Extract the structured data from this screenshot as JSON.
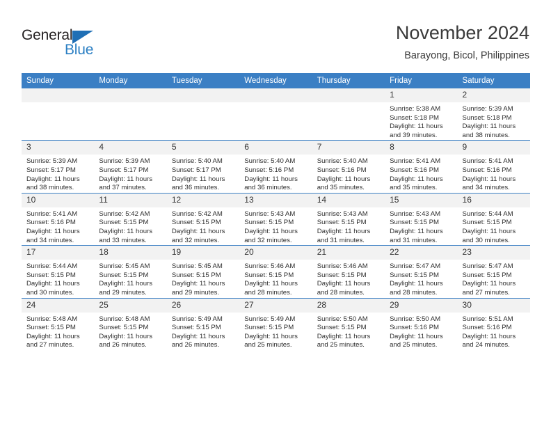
{
  "brand": {
    "name_top": "General",
    "name_bottom": "Blue"
  },
  "header": {
    "title": "November 2024",
    "subtitle": "Barayong, Bicol, Philippines"
  },
  "theme": {
    "accent": "#3b7fc4",
    "daynum_bg": "#f2f2f2",
    "text": "#2e2e2e"
  },
  "weekdays": [
    "Sunday",
    "Monday",
    "Tuesday",
    "Wednesday",
    "Thursday",
    "Friday",
    "Saturday"
  ],
  "weeks": [
    [
      {
        "day": "",
        "blank": true
      },
      {
        "day": "",
        "blank": true
      },
      {
        "day": "",
        "blank": true
      },
      {
        "day": "",
        "blank": true
      },
      {
        "day": "",
        "blank": true
      },
      {
        "day": "1",
        "sunrise": "Sunrise: 5:38 AM",
        "sunset": "Sunset: 5:18 PM",
        "daylight": "Daylight: 11 hours and 39 minutes."
      },
      {
        "day": "2",
        "sunrise": "Sunrise: 5:39 AM",
        "sunset": "Sunset: 5:18 PM",
        "daylight": "Daylight: 11 hours and 38 minutes."
      }
    ],
    [
      {
        "day": "3",
        "sunrise": "Sunrise: 5:39 AM",
        "sunset": "Sunset: 5:17 PM",
        "daylight": "Daylight: 11 hours and 38 minutes."
      },
      {
        "day": "4",
        "sunrise": "Sunrise: 5:39 AM",
        "sunset": "Sunset: 5:17 PM",
        "daylight": "Daylight: 11 hours and 37 minutes."
      },
      {
        "day": "5",
        "sunrise": "Sunrise: 5:40 AM",
        "sunset": "Sunset: 5:17 PM",
        "daylight": "Daylight: 11 hours and 36 minutes."
      },
      {
        "day": "6",
        "sunrise": "Sunrise: 5:40 AM",
        "sunset": "Sunset: 5:16 PM",
        "daylight": "Daylight: 11 hours and 36 minutes."
      },
      {
        "day": "7",
        "sunrise": "Sunrise: 5:40 AM",
        "sunset": "Sunset: 5:16 PM",
        "daylight": "Daylight: 11 hours and 35 minutes."
      },
      {
        "day": "8",
        "sunrise": "Sunrise: 5:41 AM",
        "sunset": "Sunset: 5:16 PM",
        "daylight": "Daylight: 11 hours and 35 minutes."
      },
      {
        "day": "9",
        "sunrise": "Sunrise: 5:41 AM",
        "sunset": "Sunset: 5:16 PM",
        "daylight": "Daylight: 11 hours and 34 minutes."
      }
    ],
    [
      {
        "day": "10",
        "sunrise": "Sunrise: 5:41 AM",
        "sunset": "Sunset: 5:16 PM",
        "daylight": "Daylight: 11 hours and 34 minutes."
      },
      {
        "day": "11",
        "sunrise": "Sunrise: 5:42 AM",
        "sunset": "Sunset: 5:15 PM",
        "daylight": "Daylight: 11 hours and 33 minutes."
      },
      {
        "day": "12",
        "sunrise": "Sunrise: 5:42 AM",
        "sunset": "Sunset: 5:15 PM",
        "daylight": "Daylight: 11 hours and 32 minutes."
      },
      {
        "day": "13",
        "sunrise": "Sunrise: 5:43 AM",
        "sunset": "Sunset: 5:15 PM",
        "daylight": "Daylight: 11 hours and 32 minutes."
      },
      {
        "day": "14",
        "sunrise": "Sunrise: 5:43 AM",
        "sunset": "Sunset: 5:15 PM",
        "daylight": "Daylight: 11 hours and 31 minutes."
      },
      {
        "day": "15",
        "sunrise": "Sunrise: 5:43 AM",
        "sunset": "Sunset: 5:15 PM",
        "daylight": "Daylight: 11 hours and 31 minutes."
      },
      {
        "day": "16",
        "sunrise": "Sunrise: 5:44 AM",
        "sunset": "Sunset: 5:15 PM",
        "daylight": "Daylight: 11 hours and 30 minutes."
      }
    ],
    [
      {
        "day": "17",
        "sunrise": "Sunrise: 5:44 AM",
        "sunset": "Sunset: 5:15 PM",
        "daylight": "Daylight: 11 hours and 30 minutes."
      },
      {
        "day": "18",
        "sunrise": "Sunrise: 5:45 AM",
        "sunset": "Sunset: 5:15 PM",
        "daylight": "Daylight: 11 hours and 29 minutes."
      },
      {
        "day": "19",
        "sunrise": "Sunrise: 5:45 AM",
        "sunset": "Sunset: 5:15 PM",
        "daylight": "Daylight: 11 hours and 29 minutes."
      },
      {
        "day": "20",
        "sunrise": "Sunrise: 5:46 AM",
        "sunset": "Sunset: 5:15 PM",
        "daylight": "Daylight: 11 hours and 28 minutes."
      },
      {
        "day": "21",
        "sunrise": "Sunrise: 5:46 AM",
        "sunset": "Sunset: 5:15 PM",
        "daylight": "Daylight: 11 hours and 28 minutes."
      },
      {
        "day": "22",
        "sunrise": "Sunrise: 5:47 AM",
        "sunset": "Sunset: 5:15 PM",
        "daylight": "Daylight: 11 hours and 28 minutes."
      },
      {
        "day": "23",
        "sunrise": "Sunrise: 5:47 AM",
        "sunset": "Sunset: 5:15 PM",
        "daylight": "Daylight: 11 hours and 27 minutes."
      }
    ],
    [
      {
        "day": "24",
        "sunrise": "Sunrise: 5:48 AM",
        "sunset": "Sunset: 5:15 PM",
        "daylight": "Daylight: 11 hours and 27 minutes."
      },
      {
        "day": "25",
        "sunrise": "Sunrise: 5:48 AM",
        "sunset": "Sunset: 5:15 PM",
        "daylight": "Daylight: 11 hours and 26 minutes."
      },
      {
        "day": "26",
        "sunrise": "Sunrise: 5:49 AM",
        "sunset": "Sunset: 5:15 PM",
        "daylight": "Daylight: 11 hours and 26 minutes."
      },
      {
        "day": "27",
        "sunrise": "Sunrise: 5:49 AM",
        "sunset": "Sunset: 5:15 PM",
        "daylight": "Daylight: 11 hours and 25 minutes."
      },
      {
        "day": "28",
        "sunrise": "Sunrise: 5:50 AM",
        "sunset": "Sunset: 5:15 PM",
        "daylight": "Daylight: 11 hours and 25 minutes."
      },
      {
        "day": "29",
        "sunrise": "Sunrise: 5:50 AM",
        "sunset": "Sunset: 5:16 PM",
        "daylight": "Daylight: 11 hours and 25 minutes."
      },
      {
        "day": "30",
        "sunrise": "Sunrise: 5:51 AM",
        "sunset": "Sunset: 5:16 PM",
        "daylight": "Daylight: 11 hours and 24 minutes."
      }
    ]
  ]
}
